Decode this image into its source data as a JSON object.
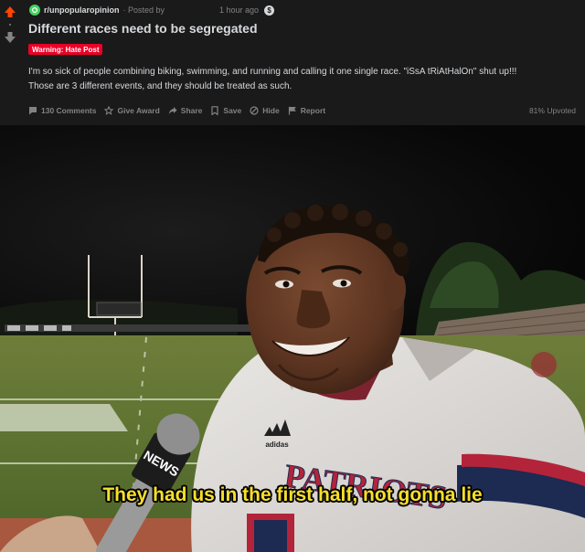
{
  "post": {
    "subreddit": "r/unpopularopinion",
    "posted_by": "· Posted by",
    "time": "1 hour ago",
    "title": "Different races need to be segregated",
    "flair": "Warning: Hate Post",
    "body_line1": "I'm so sick of people combining biking, swimming, and running and calling it one single race. \"iSsA tRiAtHalOn\" shut up!!!",
    "body_line2": "Those are 3 different events, and they should be treated as such.",
    "upvoted": "81% Upvoted"
  },
  "actions": {
    "comments": "130 Comments",
    "give_award": "Give Award",
    "share": "Share",
    "save": "Save",
    "hide": "Hide",
    "report": "Report"
  },
  "meme": {
    "caption": "They had us in the first half, not gonna lie",
    "mic_brand": "NEWS",
    "jersey_text": "PATRIOTS",
    "jersey_brand": "adidas"
  },
  "colors": {
    "upvote": "#ff4500",
    "flair": "#ea0027",
    "subreddit_icon": "#46d160",
    "caption": "#f7df2a"
  },
  "icons": [
    "upvote-icon",
    "downvote-icon",
    "subreddit-icon",
    "award-icon",
    "comment-icon",
    "gift-icon",
    "share-icon",
    "save-icon",
    "hide-icon",
    "report-icon"
  ]
}
